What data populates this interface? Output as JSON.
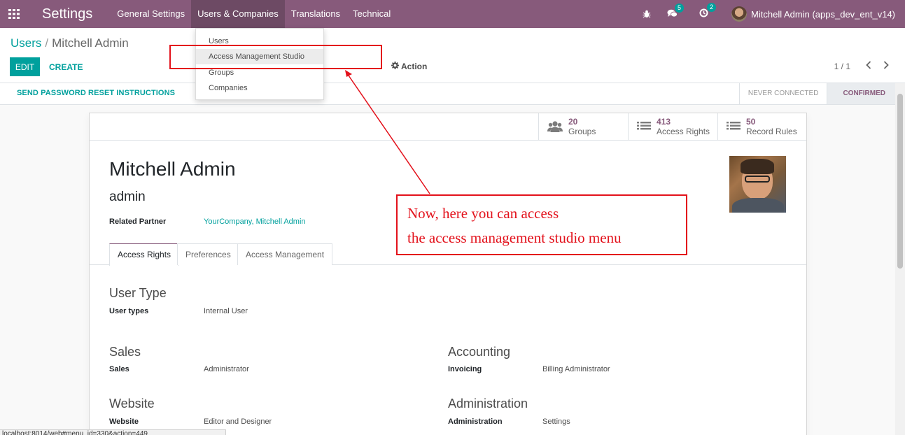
{
  "navbar": {
    "brand": "Settings",
    "menu": [
      "General Settings",
      "Users & Companies",
      "Translations",
      "Technical"
    ],
    "messages_count": "5",
    "activities_count": "2",
    "user": "Mitchell Admin (apps_dev_ent_v14)"
  },
  "dropdown": {
    "items": [
      "Users",
      "Access Management Studio",
      "Groups",
      "Companies"
    ]
  },
  "control_panel": {
    "breadcrumb_parent": "Users",
    "breadcrumb_separator": "/",
    "breadcrumb_current": "Mitchell Admin",
    "edit_label": "EDIT",
    "create_label": "CREATE",
    "action_label": "Action",
    "pager": "1 / 1"
  },
  "statusbar": {
    "reset_label": "SEND PASSWORD RESET INSTRUCTIONS",
    "steps": [
      "NEVER CONNECTED",
      "CONFIRMED"
    ]
  },
  "stats": [
    {
      "value": "20",
      "label": "Groups",
      "icon": "users-icon"
    },
    {
      "value": "413",
      "label": "Access Rights",
      "icon": "list-icon"
    },
    {
      "value": "50",
      "label": "Record Rules",
      "icon": "list-icon"
    }
  ],
  "user": {
    "name": "Mitchell Admin",
    "login": "admin",
    "related_partner_label": "Related Partner",
    "related_partner": "YourCompany, Mitchell Admin"
  },
  "tabs": [
    "Access Rights",
    "Preferences",
    "Access Management"
  ],
  "sections": {
    "user_type": {
      "title": "User Type",
      "label": "User types",
      "value": "Internal User"
    },
    "sales": {
      "title": "Sales",
      "label": "Sales",
      "value": "Administrator"
    },
    "accounting": {
      "title": "Accounting",
      "label": "Invoicing",
      "value": "Billing Administrator"
    },
    "website": {
      "title": "Website",
      "label": "Website",
      "value": "Editor and Designer"
    },
    "administration": {
      "title": "Administration",
      "label": "Administration",
      "value": "Settings"
    }
  },
  "annotation": {
    "line1": "Now, here you can access",
    "line2": "the access management studio menu"
  },
  "url_tooltip": "localhost:8014/web#menu_id=330&action=449",
  "colors": {
    "brand": "#875A7B",
    "accent": "#00A09D",
    "annotation": "#e3111b"
  }
}
